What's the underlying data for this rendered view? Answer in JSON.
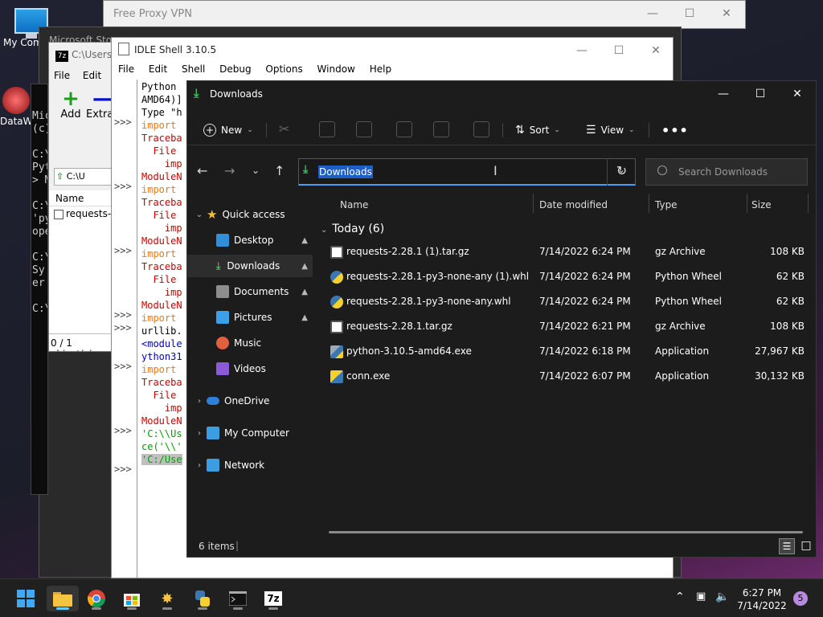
{
  "desktop": {
    "icons": [
      {
        "label": "My Com"
      },
      {
        "label": "DataW"
      }
    ]
  },
  "vpn_window": {
    "title": "Free Proxy VPN"
  },
  "store_window": {
    "title": "Microsoft Store"
  },
  "sevenzip_window": {
    "title": "C:\\Users\\",
    "menu": [
      "File",
      "Edit",
      "V"
    ],
    "toolbar": {
      "add": "Add",
      "extract": "Extrac"
    },
    "address": "C:\\U",
    "column_name": "Name",
    "file_row": "requests-2",
    "status": "0 / 1 object(s)"
  },
  "cmd_window": {
    "lines": [
      "Mic",
      "(c)",
      "C:\\",
      "Pyt",
      "> M",
      "C:\\",
      "'py",
      "ope",
      "C:\\",
      "Sy",
      " er",
      "C:\\"
    ]
  },
  "idle_window": {
    "title": "IDLE Shell 3.10.5",
    "menu": [
      "File",
      "Edit",
      "Shell",
      "Debug",
      "Options",
      "Window",
      "Help"
    ],
    "prompts": [
      ">>>",
      ">>>",
      ">>>",
      ">>>",
      ">>>",
      ">>>",
      ">>>",
      ">>>"
    ],
    "code_lines": [
      {
        "text": "Python",
        "color": "b"
      },
      {
        "text": "AMD64)]",
        "color": "b"
      },
      {
        "text": "Type \"h",
        "color": "b"
      },
      {
        "text": "import",
        "color": "k"
      },
      {
        "text": "Traceba",
        "color": "r"
      },
      {
        "text": "  File",
        "color": "r"
      },
      {
        "text": "    imp",
        "color": "r"
      },
      {
        "text": "ModuleN",
        "color": "r"
      },
      {
        "text": "import",
        "color": "k"
      },
      {
        "text": "Traceba",
        "color": "r"
      },
      {
        "text": "  File",
        "color": "r"
      },
      {
        "text": "    imp",
        "color": "r"
      },
      {
        "text": "ModuleN",
        "color": "r"
      },
      {
        "text": "import",
        "color": "k"
      },
      {
        "text": "Traceba",
        "color": "r"
      },
      {
        "text": "  File",
        "color": "r"
      },
      {
        "text": "    imp",
        "color": "r"
      },
      {
        "text": "ModuleN",
        "color": "r"
      },
      {
        "text": "import",
        "color": "k"
      },
      {
        "text": "urllib.",
        "color": "b"
      },
      {
        "text": "<module",
        "color": "bl"
      },
      {
        "text": "ython31",
        "color": "bl"
      },
      {
        "text": "import",
        "color": "k"
      },
      {
        "text": "Traceba",
        "color": "r"
      },
      {
        "text": "  File",
        "color": "r"
      },
      {
        "text": "    imp",
        "color": "r"
      },
      {
        "text": "ModuleN",
        "color": "r"
      },
      {
        "text": "'C:\\\\Us",
        "color": "g"
      },
      {
        "text": "ce('\\\\'",
        "color": "g"
      },
      {
        "text": "'C:/Use",
        "color": "g"
      }
    ]
  },
  "explorer": {
    "title": "Downloads",
    "toolbar": {
      "new": "New",
      "sort": "Sort",
      "view": "View"
    },
    "address": "Downloads",
    "search_placeholder": "Search Downloads",
    "nav": {
      "quick_access": "Quick access",
      "desktop": "Desktop",
      "downloads": "Downloads",
      "documents": "Documents",
      "pictures": "Pictures",
      "music": "Music",
      "videos": "Videos",
      "onedrive": "OneDrive",
      "my_computer": "My Computer",
      "network": "Network"
    },
    "columns": {
      "name": "Name",
      "date": "Date modified",
      "type": "Type",
      "size": "Size"
    },
    "group": "Today (6)",
    "files": [
      {
        "name": "requests-2.28.1 (1).tar.gz",
        "date": "7/14/2022 6:24 PM",
        "type": "gz Archive",
        "size": "108 KB",
        "icon": "archive-icon"
      },
      {
        "name": "requests-2.28.1-py3-none-any (1).whl",
        "date": "7/14/2022 6:24 PM",
        "type": "Python Wheel",
        "size": "62 KB",
        "icon": "python-wheel-icon"
      },
      {
        "name": "requests-2.28.1-py3-none-any.whl",
        "date": "7/14/2022 6:24 PM",
        "type": "Python Wheel",
        "size": "62 KB",
        "icon": "python-wheel-icon"
      },
      {
        "name": "requests-2.28.1.tar.gz",
        "date": "7/14/2022 6:21 PM",
        "type": "gz Archive",
        "size": "108 KB",
        "icon": "archive-icon"
      },
      {
        "name": "python-3.10.5-amd64.exe",
        "date": "7/14/2022 6:18 PM",
        "type": "Application",
        "size": "27,967 KB",
        "icon": "installer-icon"
      },
      {
        "name": "conn.exe",
        "date": "7/14/2022 6:07 PM",
        "type": "Application",
        "size": "30,132 KB",
        "icon": "app-icon"
      }
    ],
    "status": "6 items"
  },
  "taskbar": {
    "time": "6:27 PM",
    "date": "7/14/2022",
    "notifications": "5"
  }
}
